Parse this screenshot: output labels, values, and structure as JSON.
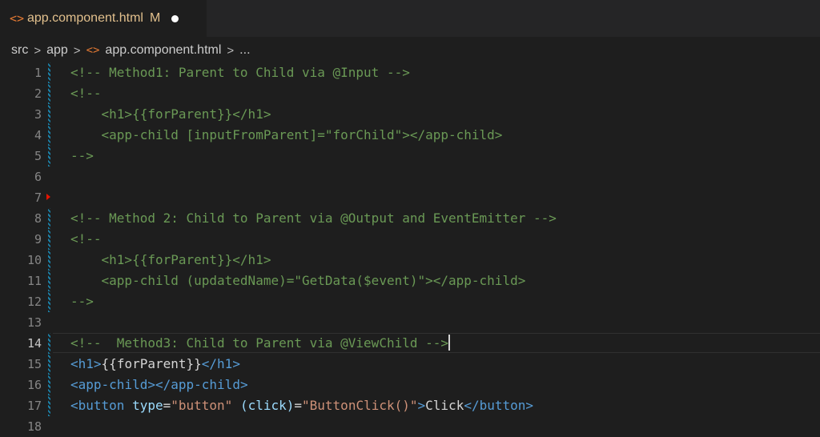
{
  "tab": {
    "icon": "angle-brackets-icon",
    "label": "app.component.html",
    "badge": "M"
  },
  "breadcrumb": {
    "items": [
      "src",
      "app",
      "app.component.html",
      "..."
    ],
    "separator": ">",
    "file_icon": "angle-brackets-icon"
  },
  "editor": {
    "active_line": 14,
    "lines": [
      {
        "n": "1",
        "text": "<!-- Method1: Parent to Child via @Input -->"
      },
      {
        "n": "2",
        "text": "<!--"
      },
      {
        "n": "3",
        "text": "    <h1>{{forParent}}</h1>"
      },
      {
        "n": "4",
        "text": "    <app-child [inputFromParent]=\"forChild\"></app-child>"
      },
      {
        "n": "5",
        "text": "-->"
      },
      {
        "n": "6",
        "text": ""
      },
      {
        "n": "7",
        "text": ""
      },
      {
        "n": "8",
        "text": "<!-- Method 2: Child to Parent via @Output and EventEmitter -->"
      },
      {
        "n": "9",
        "text": "<!--"
      },
      {
        "n": "10",
        "text": "    <h1>{{forParent}}</h1>"
      },
      {
        "n": "11",
        "text": "    <app-child (updatedName)=\"GetData($event)\"></app-child>"
      },
      {
        "n": "12",
        "text": "-->"
      },
      {
        "n": "13",
        "text": ""
      },
      {
        "n": "14",
        "text": "<!--  Method3: Child to Parent via @ViewChild -->"
      },
      {
        "n": "15",
        "text": "<h1>{{forParent}}</h1>"
      },
      {
        "n": "16",
        "text": "<app-child></app-child>"
      },
      {
        "n": "17",
        "text": "<button type=\"button\" (click)=\"ButtonClick()\">Click</button>"
      },
      {
        "n": "18",
        "text": ""
      }
    ]
  },
  "colors": {
    "comment": "#6a9955",
    "tag": "#569cd6",
    "attribute": "#9cdcfe",
    "string": "#ce9178",
    "modified_file": "#e2c08d",
    "gutter_modified": "#1b81a8",
    "error_marker": "#e51400"
  }
}
